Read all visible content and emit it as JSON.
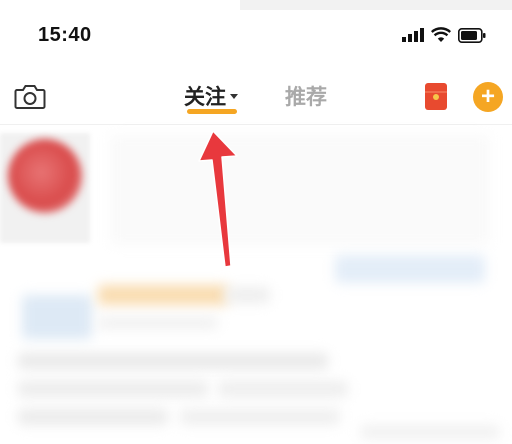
{
  "status_bar": {
    "time": "15:40",
    "icons": [
      "cellular-signal-icon",
      "wifi-icon",
      "battery-icon"
    ]
  },
  "nav": {
    "camera_icon": "camera-icon",
    "tabs": [
      {
        "label": "关注",
        "active": true,
        "has_dropdown": true
      },
      {
        "label": "推荐",
        "active": false
      }
    ],
    "red_packet_icon": "red-packet-icon",
    "add_button_label": "+"
  },
  "colors": {
    "accent": "#f5a623",
    "annotation_arrow": "#e8383d",
    "inactive_tab": "#a9a9a9"
  }
}
